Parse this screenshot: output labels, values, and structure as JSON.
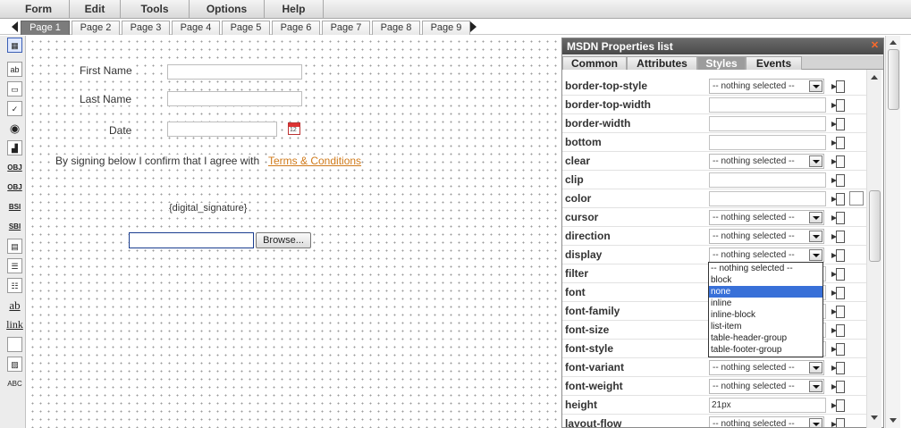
{
  "menu": [
    "Form",
    "Edit",
    "Tools",
    "Options",
    "Help"
  ],
  "pages": [
    "Page 1",
    "Page 2",
    "Page 3",
    "Page 4",
    "Page 5",
    "Page 6",
    "Page 7",
    "Page 8",
    "Page 9"
  ],
  "active_page": "Page 1",
  "toolbox": {
    "tools": [
      "insert-grid-icon",
      "text-field-icon",
      "password-field-icon",
      "checkbox-icon",
      "radio-icon",
      "chart-icon",
      "obj-1-icon",
      "obj-2-icon",
      "bsi-icon",
      "sbi-icon",
      "grid-icon",
      "list-icon",
      "label-icon",
      "link-icon",
      "box-icon",
      "image-icon",
      "spellcheck-icon"
    ],
    "labels": {
      "bsi": "BSI",
      "sbi": "SBI",
      "obj": "OBJ",
      "ab": "ab",
      "link": "link",
      "abc": "ABC"
    }
  },
  "form": {
    "first_name_label": "First Name",
    "last_name_label": "Last Name",
    "date_label": "Date",
    "calendar_day": "12",
    "agreement_text": "By signing below I confirm that I agree with",
    "terms_link": "Terms & Conditions",
    "signature_placeholder": "{digital_signature}",
    "browse_label": "Browse..."
  },
  "panel": {
    "title": "MSDN Properties list",
    "tabs": [
      "Common",
      "Attributes",
      "Styles",
      "Events"
    ],
    "active_tab": "Styles",
    "rows": [
      {
        "name": "border-top-style",
        "type": "select",
        "value": "-- nothing selected --"
      },
      {
        "name": "border-top-width",
        "type": "input",
        "value": ""
      },
      {
        "name": "border-width",
        "type": "input",
        "value": ""
      },
      {
        "name": "bottom",
        "type": "input",
        "value": ""
      },
      {
        "name": "clear",
        "type": "select",
        "value": "-- nothing selected --"
      },
      {
        "name": "clip",
        "type": "input",
        "value": ""
      },
      {
        "name": "color",
        "type": "color",
        "value": ""
      },
      {
        "name": "cursor",
        "type": "select",
        "value": "-- nothing selected --"
      },
      {
        "name": "direction",
        "type": "select",
        "value": "-- nothing selected --"
      },
      {
        "name": "display",
        "type": "select",
        "value": "-- nothing selected --"
      },
      {
        "name": "filter",
        "type": "input",
        "value": ""
      },
      {
        "name": "font",
        "type": "input",
        "value": ""
      },
      {
        "name": "font-family",
        "type": "input",
        "value": ""
      },
      {
        "name": "font-size",
        "type": "input",
        "value": ""
      },
      {
        "name": "font-style",
        "type": "input",
        "value": ""
      },
      {
        "name": "font-variant",
        "type": "select",
        "value": "-- nothing selected --"
      },
      {
        "name": "font-weight",
        "type": "select",
        "value": "-- nothing selected --"
      },
      {
        "name": "height",
        "type": "input",
        "value": "21px"
      },
      {
        "name": "layout-flow",
        "type": "select",
        "value": "-- nothing selected --"
      }
    ],
    "display_options": [
      "-- nothing selected --",
      "block",
      "none",
      "inline",
      "inline-block",
      "list-item",
      "table-header-group",
      "table-footer-group"
    ],
    "display_highlighted": "none"
  },
  "colors": {
    "accent_link": "#d07a1a",
    "selection": "#3870d8",
    "close": "#ff6a2a"
  }
}
